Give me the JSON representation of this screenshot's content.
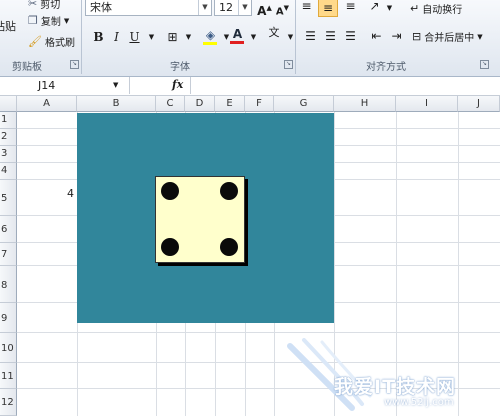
{
  "clipboard": {
    "paste": "粘贴",
    "cut": "剪切",
    "copy": "复制",
    "format_painter": "格式刷",
    "group_label": "剪贴板"
  },
  "font": {
    "name": "宋体",
    "size": "12",
    "group_label": "字体",
    "bold": "B",
    "italic": "I",
    "underline": "U",
    "grow": "A",
    "shrink": "A",
    "phonetic": "文"
  },
  "alignment": {
    "wrap_text": "自动换行",
    "merge_center": "合并后居中",
    "group_label": "对齐方式"
  },
  "formula_bar": {
    "name_box": "J14",
    "fx": "fx",
    "value": ""
  },
  "columns": [
    "A",
    "B",
    "C",
    "D",
    "E",
    "F",
    "G",
    "H",
    "I",
    "J"
  ],
  "rows": [
    "1",
    "2",
    "3",
    "4",
    "5",
    "6",
    "7",
    "8",
    "9",
    "10",
    "11",
    "12"
  ],
  "cells": {
    "A5": "4"
  },
  "colors": {
    "fill": "#31869b",
    "die_face": "#ffffcc",
    "pip": "#0a0a0a",
    "font_color_bar": "#e02020",
    "fill_color_bar": "#ffff00"
  },
  "watermark": {
    "text": "我爱IT技术网",
    "url": "www.52ij.com"
  }
}
